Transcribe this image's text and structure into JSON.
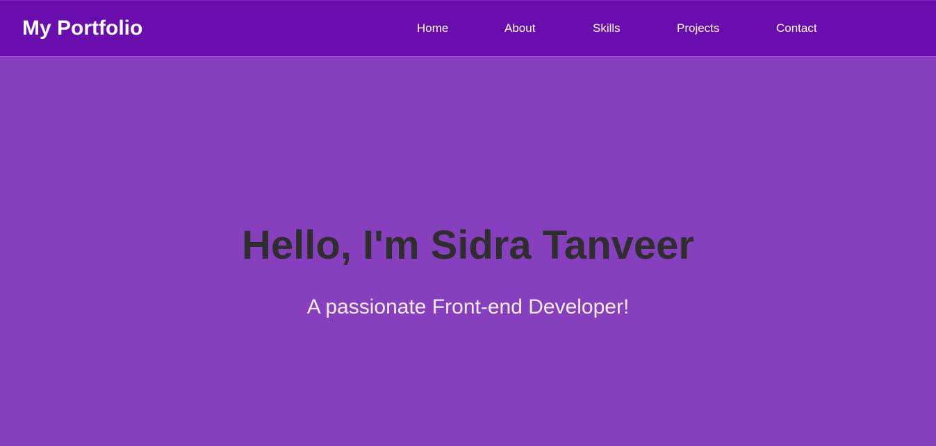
{
  "header": {
    "brand": "My Portfolio",
    "nav": {
      "home": "Home",
      "about": "About",
      "skills": "Skills",
      "projects": "Projects",
      "contact": "Contact"
    }
  },
  "hero": {
    "title": "Hello, I'm Sidra Tanveer",
    "subtitle": "A passionate Front-end Developer!"
  },
  "colors": {
    "navbar": "#6a0dad",
    "background": "#8640bd",
    "title_text": "#2e2e2e",
    "subtitle_text": "#f3ecfa"
  }
}
